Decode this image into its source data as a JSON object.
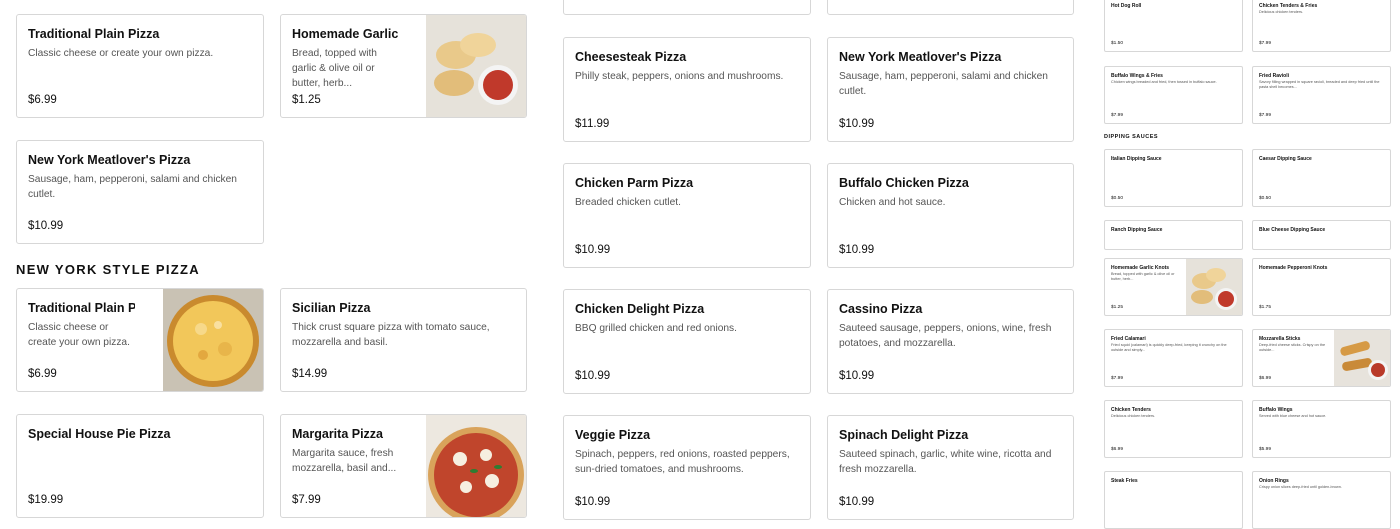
{
  "colors": {
    "card_border": "#d7d7d7",
    "title": "#111111",
    "desc": "#555555"
  },
  "col1": {
    "top_items": [
      {
        "title": "Traditional Plain Pizza",
        "desc": "Classic cheese or create your own pizza.",
        "price": "$6.99"
      },
      {
        "title": "New York Meatlover's Pizza",
        "desc": "Sausage, ham, pepperoni, salami and chicken cutlet.",
        "price": "$10.99"
      }
    ],
    "section_title": "NEW YORK STYLE PIZZA",
    "bottom_items": [
      {
        "title": "Traditional Plain Pizza",
        "desc": "Classic cheese or create your own pizza.",
        "price": "$6.99"
      },
      {
        "title": "Special House Pie Pizza",
        "desc": "",
        "price": "$19.99"
      }
    ]
  },
  "col2": {
    "items": [
      {
        "title": "Homemade Garlic Knots",
        "desc": "Bread, topped with garlic & olive oil or butter, herb...",
        "price": "$1.25"
      },
      {
        "title": "Sicilian Pizza",
        "desc": "Thick crust square pizza with tomato sauce, mozzarella and basil.",
        "price": "$14.99"
      },
      {
        "title": "Margarita Pizza",
        "desc": "Margarita sauce, fresh mozzarella, basil and...",
        "price": "$7.99"
      }
    ]
  },
  "col3": {
    "items": [
      {
        "title": "",
        "desc": "",
        "price": ""
      },
      {
        "title": "Cheesesteak Pizza",
        "desc": "Philly steak, peppers, onions and mushrooms.",
        "price": "$11.99"
      },
      {
        "title": "Chicken Parm Pizza",
        "desc": "Breaded chicken cutlet.",
        "price": "$10.99"
      },
      {
        "title": "Chicken Delight Pizza",
        "desc": "BBQ grilled chicken and red onions.",
        "price": "$10.99"
      },
      {
        "title": "Veggie Pizza",
        "desc": "Spinach, peppers, red onions, roasted peppers, sun-dried tomatoes, and mushrooms.",
        "price": "$10.99"
      }
    ]
  },
  "col4": {
    "items": [
      {
        "title": "",
        "desc": "",
        "price": ""
      },
      {
        "title": "New York Meatlover's Pizza",
        "desc": "Sausage, ham, pepperoni, salami and chicken cutlet.",
        "price": "$10.99"
      },
      {
        "title": "Buffalo Chicken Pizza",
        "desc": "Chicken and hot sauce.",
        "price": "$10.99"
      },
      {
        "title": "Cassino Pizza",
        "desc": "Sauteed sausage, peppers, onions, wine, fresh potatoes, and mozzarella.",
        "price": "$10.99"
      },
      {
        "title": "Spinach Delight Pizza",
        "desc": "Sauteed spinach, garlic, white wine, ricotta and fresh mozzarella.",
        "price": "$10.99"
      }
    ]
  },
  "col5": {
    "items": [
      {
        "title": "Hot Dog Roll",
        "desc": "",
        "price": "$1.50"
      },
      {
        "title": "Buffalo Wings & Fries",
        "desc": "Chicken wings breaded and fried, then tossed in buffalo sauce.",
        "price": "$7.99"
      }
    ],
    "section_title": "DIPPING SAUCES",
    "sauces": [
      {
        "title": "Italian Dipping Sauce",
        "desc": "",
        "price": "$0.50"
      },
      {
        "title": "Ranch Dipping Sauce",
        "desc": "",
        "price": ""
      },
      {
        "title": "Homemade Garlic Knots",
        "desc": "Bread, topped with garlic & olive oil or butter, herb...",
        "price": "$1.25"
      },
      {
        "title": "Fried Calamari",
        "desc": "Fried squid (calamari) is quickly deep-fried, keeping it crunchy on the outside and simply...",
        "price": "$7.99"
      },
      {
        "title": "Chicken Tenders",
        "desc": "Delicious chicken tenders.",
        "price": "$6.99"
      },
      {
        "title": "Steak Fries",
        "desc": "",
        "price": ""
      }
    ]
  },
  "col6": {
    "items": [
      {
        "title": "Chicken Tenders & Fries",
        "desc": "Delicious chicken tenders.",
        "price": "$7.99"
      },
      {
        "title": "Fried Ravioli",
        "desc": "Savory filling wrapped in square ravioli, breaded and deep fried until the pasta shell becomes...",
        "price": "$7.99"
      }
    ],
    "sauces": [
      {
        "title": "Caesar Dipping Sauce",
        "desc": "",
        "price": "$0.50"
      },
      {
        "title": "Blue Cheese Dipping Sauce",
        "desc": "",
        "price": ""
      },
      {
        "title": "Homemade Pepperoni Knots",
        "desc": "",
        "price": "$1.75"
      },
      {
        "title": "Mozzarella Sticks",
        "desc": "Deep-fried cheese sticks. Crispy on the outside...",
        "price": "$6.99"
      },
      {
        "title": "Buffalo Wings",
        "desc": "Served with blue cheese and hot sauce.",
        "price": "$5.99"
      },
      {
        "title": "Onion Rings",
        "desc": "Crispy onion slices deep-fried until golden-brown.",
        "price": ""
      }
    ]
  }
}
